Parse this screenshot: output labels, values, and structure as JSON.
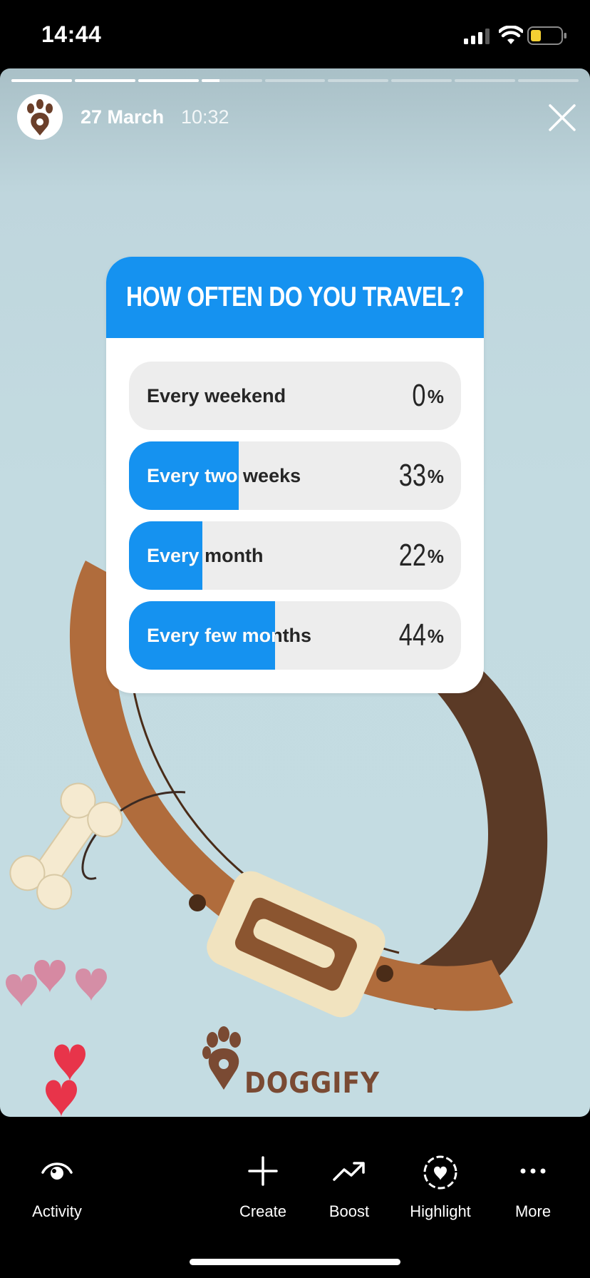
{
  "status_bar": {
    "time": "14:44"
  },
  "story": {
    "progress": [
      1,
      1,
      1,
      0.3,
      0,
      0,
      0,
      0,
      0
    ],
    "date": "27 March",
    "time": "10:32"
  },
  "poll": {
    "question": "HOW OFTEN DO YOU TRAVEL?",
    "percent_sign": "%",
    "options": [
      {
        "label": "Every weekend",
        "percent": "0"
      },
      {
        "label": "Every two weeks",
        "percent": "33"
      },
      {
        "label": "Every month",
        "percent": "22"
      },
      {
        "label": "Every few months",
        "percent": "44"
      }
    ]
  },
  "brand": {
    "name": "DOGGIFY"
  },
  "bottom_bar": {
    "activity": "Activity",
    "create": "Create",
    "boost": "Boost",
    "highlight": "Highlight",
    "more": "More"
  },
  "colors": {
    "accent": "#1592f0",
    "collar": "#b06c3c",
    "heart": "#e8344a"
  }
}
